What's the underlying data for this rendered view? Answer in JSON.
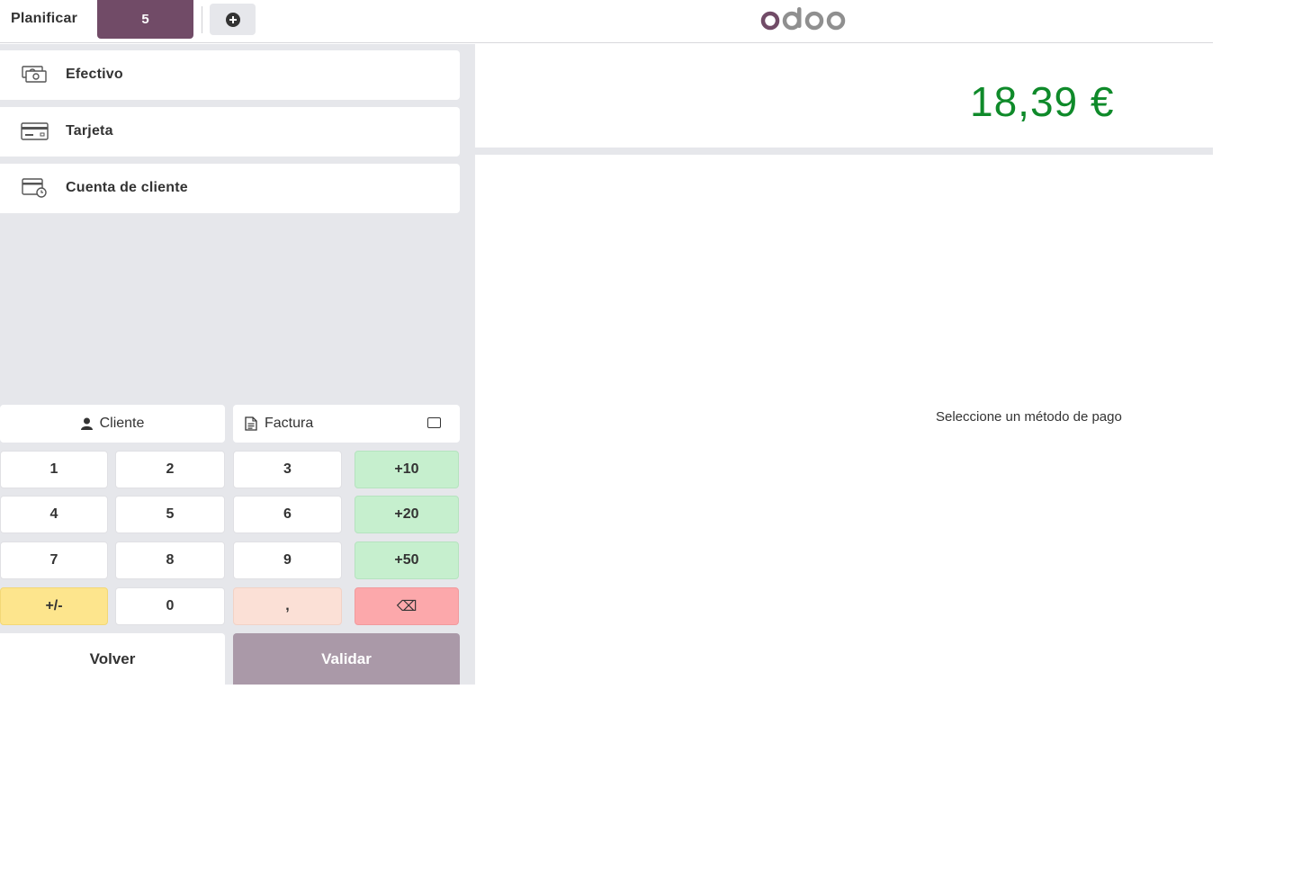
{
  "topbar": {
    "plan_label": "Planificar",
    "order_tab": "5",
    "add_order_icon": "plus-circle-icon",
    "logo_text": "odoo"
  },
  "payment_methods": [
    {
      "label": "Efectivo",
      "icon": "cash-icon"
    },
    {
      "label": "Tarjeta",
      "icon": "card-icon"
    },
    {
      "label": "Cuenta de cliente",
      "icon": "customer-account-icon"
    }
  ],
  "controls": {
    "customer_label": "Cliente",
    "customer_icon": "user-icon",
    "invoice_label": "Factura",
    "invoice_icon": "document-icon",
    "invoice_checked": false
  },
  "numpad": {
    "k1": "1",
    "k2": "2",
    "k3": "3",
    "k_plus10": "+10",
    "k4": "4",
    "k5": "5",
    "k6": "6",
    "k_plus20": "+20",
    "k7": "7",
    "k8": "8",
    "k9": "9",
    "k_plus50": "+50",
    "k_sign": "+/-",
    "k0": "0",
    "k_decimal": ",",
    "k_backspace": "⌫"
  },
  "actions": {
    "back_label": "Volver",
    "validate_label": "Validar"
  },
  "summary": {
    "amount": "18,39 €",
    "hint": "Seleccione un método de pago"
  },
  "colors": {
    "brand": "#714b67",
    "amount": "#0f8a2a",
    "quick_add": "#c6efce",
    "sign": "#fde58d",
    "decimal": "#fbe0d6",
    "backspace": "#fca8ab",
    "validate_disabled": "#aa99a8"
  }
}
